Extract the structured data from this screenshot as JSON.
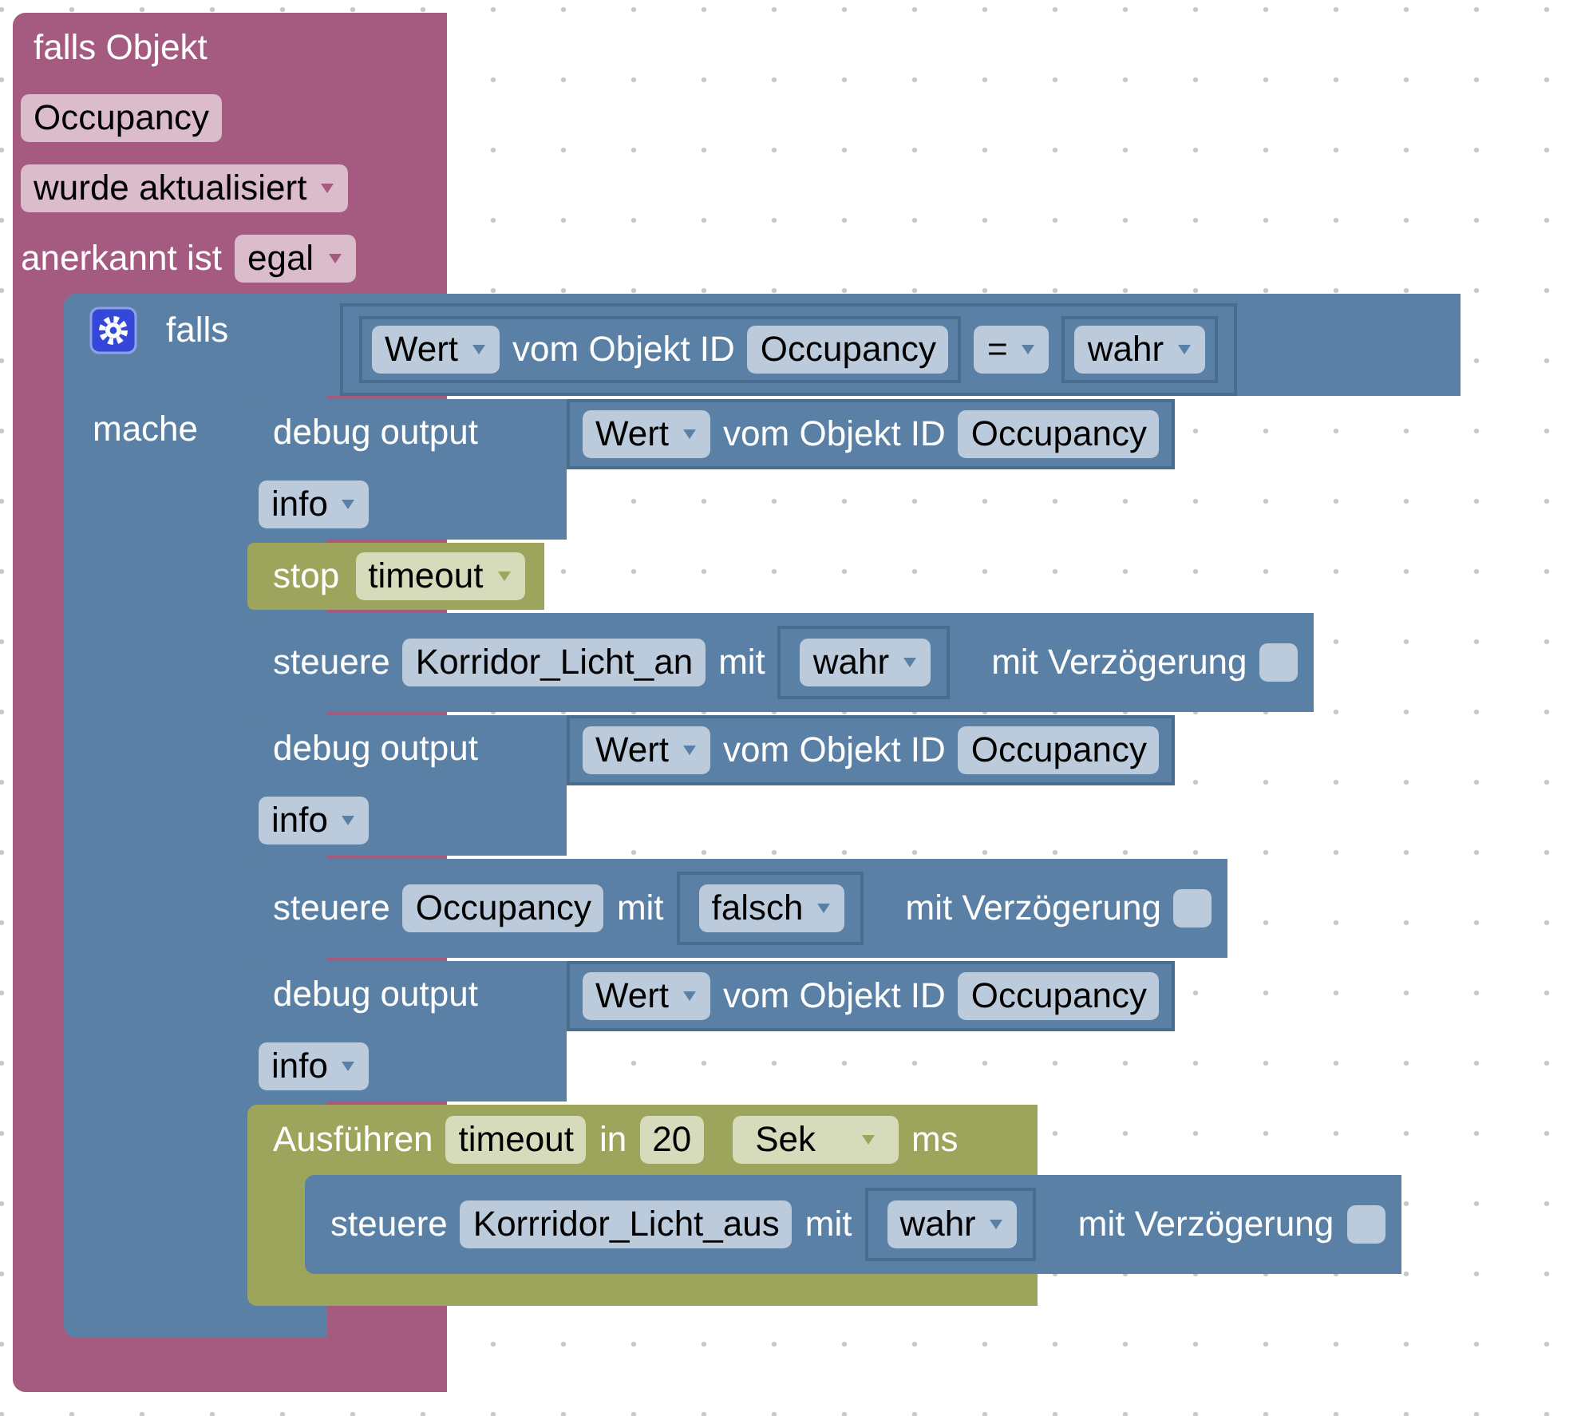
{
  "event_block": {
    "title": "falls Objekt",
    "object": "Occupancy",
    "trigger": "wurde aktualisiert",
    "ack_label": "anerkannt ist",
    "ack": "egal",
    "if_block": {
      "label": "falls",
      "do_label": "mache",
      "condition": {
        "left": {
          "field": "Wert",
          "label": "vom Objekt ID",
          "object": "Occupancy"
        },
        "operator": "=",
        "right": "wahr"
      },
      "statements": [
        {
          "kind": "debug",
          "label": "debug output",
          "value": {
            "field": "Wert",
            "label": "vom Objekt ID",
            "object": "Occupancy"
          },
          "severity": "info"
        },
        {
          "kind": "stop",
          "label": "stop",
          "timer": "timeout"
        },
        {
          "kind": "control",
          "label": "steuere",
          "object": "Korridor_Licht_an",
          "with_label": "mit",
          "value": "wahr",
          "delay_label": "mit Verzögerung",
          "delay_checked": false
        },
        {
          "kind": "debug",
          "label": "debug output",
          "value": {
            "field": "Wert",
            "label": "vom Objekt ID",
            "object": "Occupancy"
          },
          "severity": "info"
        },
        {
          "kind": "control",
          "label": "steuere",
          "object": "Occupancy",
          "with_label": "mit",
          "value": "falsch",
          "delay_label": "mit Verzögerung",
          "delay_checked": false
        },
        {
          "kind": "debug",
          "label": "debug output",
          "value": {
            "field": "Wert",
            "label": "vom Objekt ID",
            "object": "Occupancy"
          },
          "severity": "info"
        },
        {
          "kind": "timeout",
          "label": "Ausführen",
          "timer": "timeout",
          "in_label": "in",
          "amount": "20",
          "unit": "Sek",
          "unit_suffix": "ms",
          "statements": [
            {
              "kind": "control",
              "label": "steuere",
              "object": "Korrridor_Licht_aus",
              "with_label": "mit",
              "value": "wahr",
              "delay_label": "mit Verzögerung",
              "delay_checked": false
            }
          ]
        }
      ]
    }
  }
}
